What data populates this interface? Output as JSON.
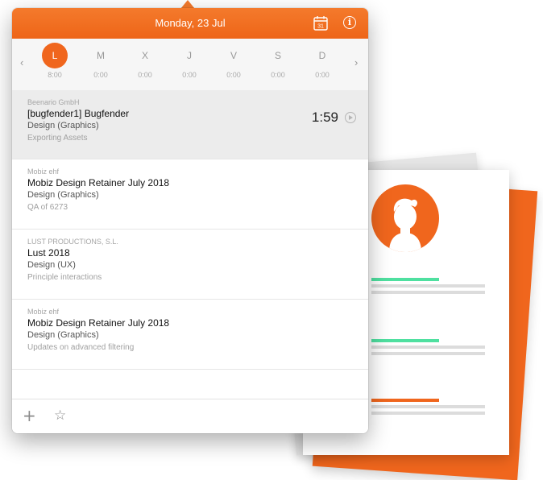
{
  "header": {
    "title": "Monday, 23 Jul",
    "calendar_icon_day": "31"
  },
  "week": {
    "days": [
      {
        "letter": "L",
        "time": "8:00",
        "active": true
      },
      {
        "letter": "M",
        "time": "0:00"
      },
      {
        "letter": "X",
        "time": "0:00"
      },
      {
        "letter": "J",
        "time": "0:00"
      },
      {
        "letter": "V",
        "time": "0:00"
      },
      {
        "letter": "S",
        "time": "0:00"
      },
      {
        "letter": "D",
        "time": "0:00"
      }
    ],
    "prev_icon": "chevron-left",
    "next_icon": "chevron-right"
  },
  "entries": [
    {
      "client": "Beenario GmbH",
      "project": "[bugfender1] Bugfender",
      "task": "Design (Graphics)",
      "note": "Exporting Assets",
      "timer": "1:59",
      "selected": true
    },
    {
      "client": "Mobiz ehf",
      "project": "Mobiz Design Retainer July 2018",
      "task": "Design (Graphics)",
      "note": "QA of 6273"
    },
    {
      "client": "LUST PRODUCTIONS, S.L.",
      "project": "Lust 2018",
      "task": "Design (UX)",
      "note": "Principle interactions"
    },
    {
      "client": "Mobiz ehf",
      "project": "Mobiz Design Retainer July 2018",
      "task": "Design (Graphics)",
      "note": "Updates on advanced filtering"
    }
  ],
  "footer": {
    "add_icon": "+",
    "star_icon": "☆"
  },
  "colors": {
    "accent": "#f0661d",
    "highlight_green": "#4fe0a0",
    "selected_row": "#ececec"
  },
  "icons": [
    "calendar-icon",
    "info-icon",
    "play-icon",
    "add-icon",
    "star-icon",
    "avatar-icon"
  ]
}
